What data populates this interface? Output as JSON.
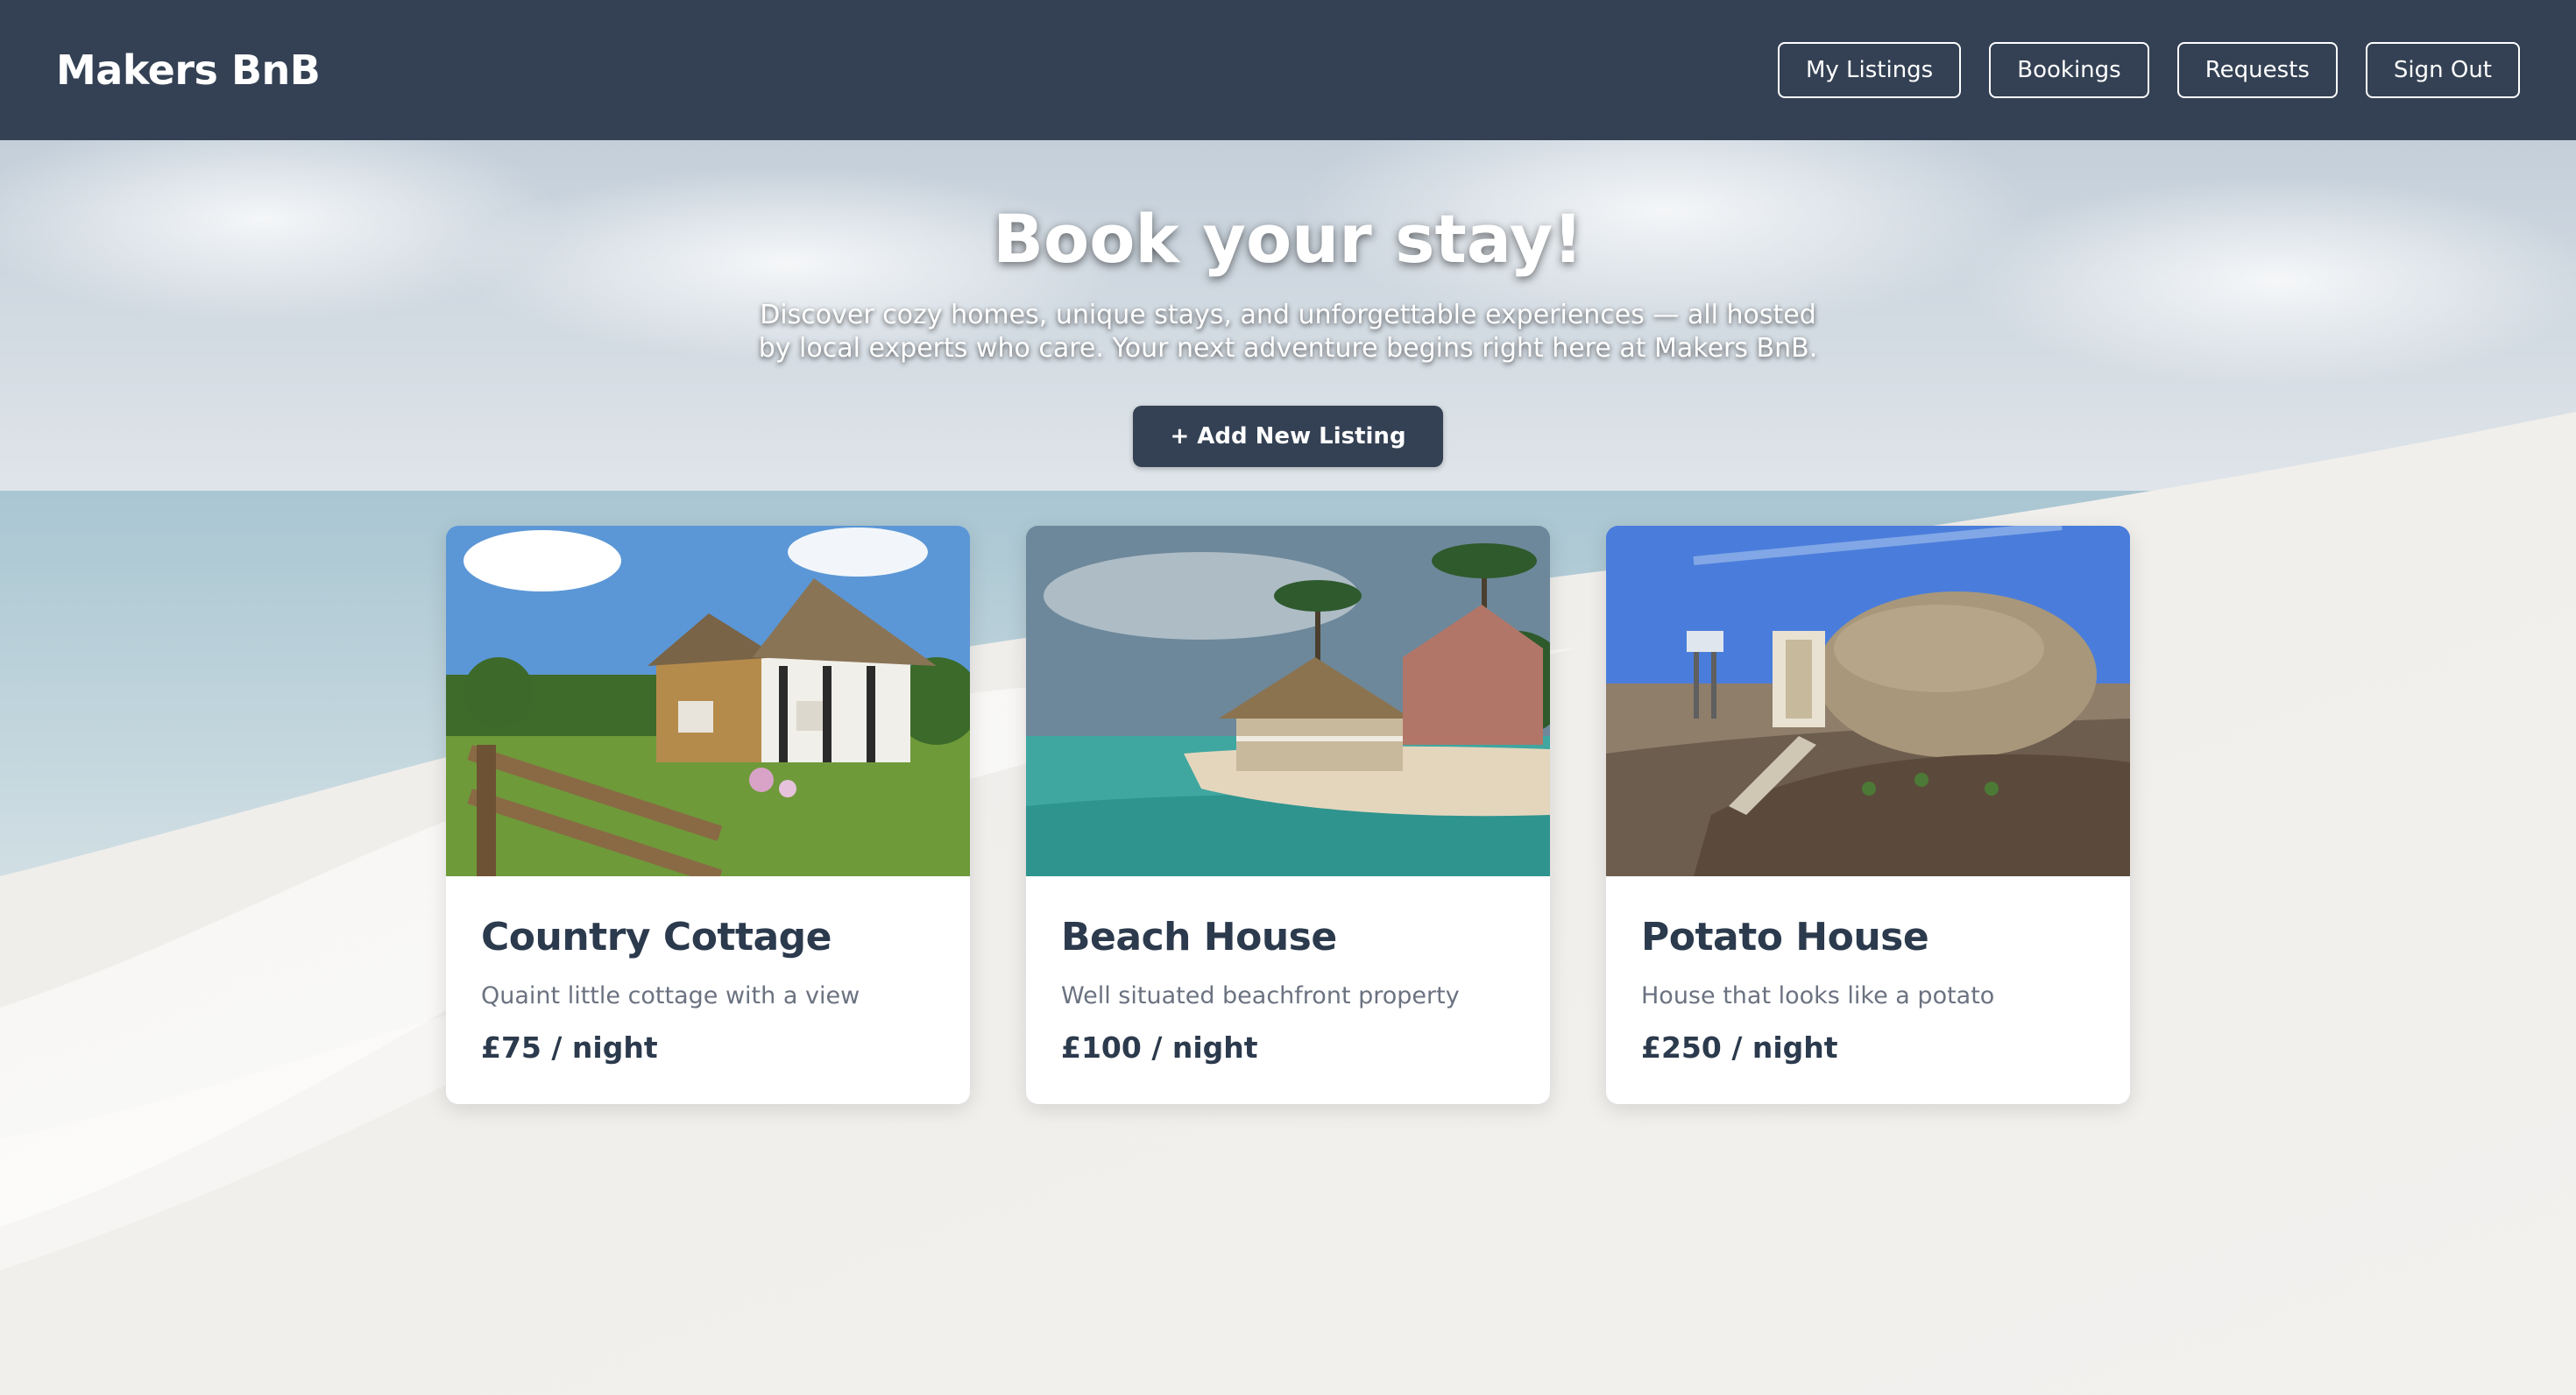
{
  "navbar": {
    "brand": "Makers BnB",
    "links": [
      "My Listings",
      "Bookings",
      "Requests",
      "Sign Out"
    ]
  },
  "hero": {
    "title": "Book your stay!",
    "subtitle": "Discover cozy homes, unique stays, and unforgettable experiences — all hosted by local experts who care. Your next adventure begins right here at Makers BnB.",
    "add_button": "+ Add New Listing"
  },
  "listings": [
    {
      "title": "Country Cottage",
      "description": "Quaint little cottage with a view",
      "price": "£75 / night"
    },
    {
      "title": "Beach House",
      "description": "Well situated beachfront property",
      "price": "£100 / night"
    },
    {
      "title": "Potato House",
      "description": "House that looks like a potato",
      "price": "£250 / night"
    }
  ],
  "colors": {
    "navbar_bg": "#344154",
    "primary_button": "#344154",
    "card_title": "#2c3a4d",
    "card_desc": "#6b7280"
  }
}
